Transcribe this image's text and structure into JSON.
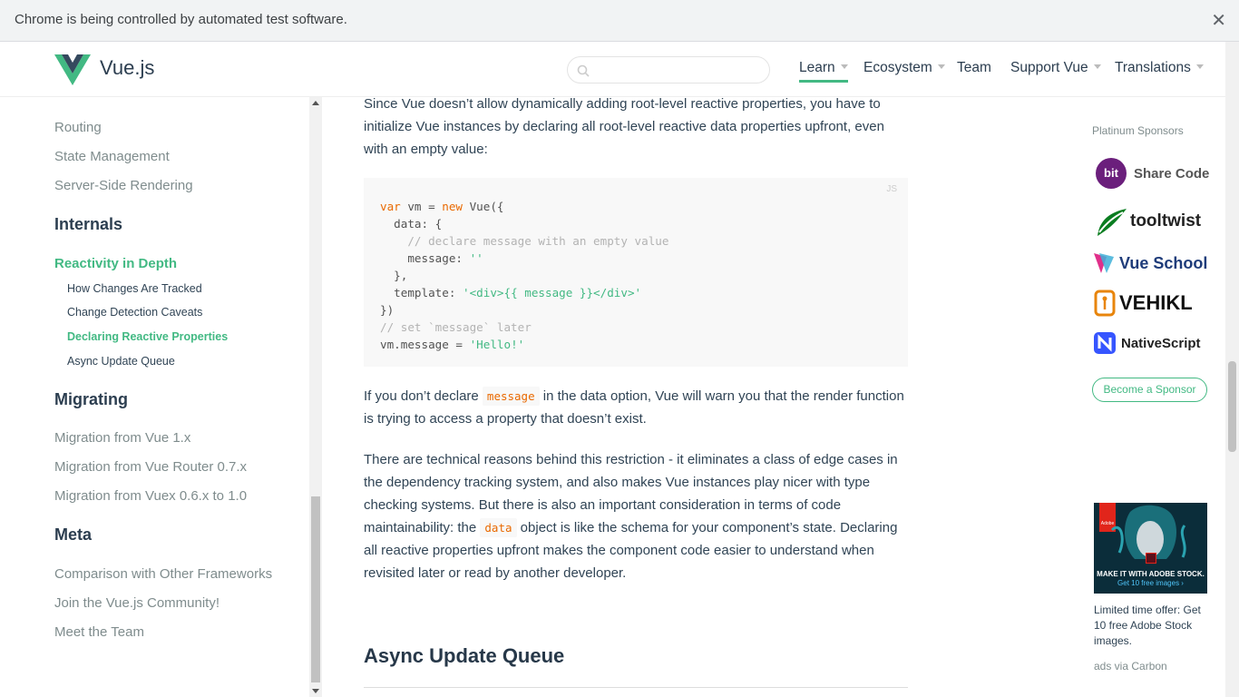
{
  "infobar": {
    "text": "Chrome is being controlled by automated test software.",
    "close": "✕"
  },
  "header": {
    "brand": "Vue.js",
    "search_placeholder": "",
    "nav": [
      {
        "label": "Learn",
        "has_caret": true,
        "active": true
      },
      {
        "label": "Ecosystem",
        "has_caret": true
      },
      {
        "label": "Team",
        "has_caret": false
      },
      {
        "label": "Support Vue",
        "has_caret": true
      },
      {
        "label": "Translations",
        "has_caret": true
      }
    ]
  },
  "sidebar": {
    "links_top": [
      "Routing",
      "State Management",
      "Server-Side Rendering"
    ],
    "internals_heading": "Internals",
    "active_page": "Reactivity in Depth",
    "sub_links": [
      "How Changes Are Tracked",
      "Change Detection Caveats",
      "Declaring Reactive Properties",
      "Async Update Queue"
    ],
    "active_sub": "Declaring Reactive Properties",
    "migrating_heading": "Migrating",
    "migrating_links": [
      "Migration from Vue 1.x",
      "Migration from Vue Router 0.7.x",
      "Migration from Vuex 0.6.x to 1.0"
    ],
    "meta_heading": "Meta",
    "meta_links": [
      "Comparison with Other Frameworks",
      "Join the Vue.js Community!",
      "Meet the Team"
    ]
  },
  "content": {
    "para1": "Since Vue doesn’t allow dynamically adding root-level reactive properties, you have to initialize Vue instances by declaring all root-level reactive data properties upfront, even with an empty value:",
    "code_lang": "JS",
    "code": {
      "l1_kw1": "var",
      "l1_mid": " vm = ",
      "l1_kw2": "new",
      "l1_end": " Vue({",
      "l2": "  data: {",
      "l3": "    // declare message with an empty value",
      "l4_pre": "    message: ",
      "l4_str": "''",
      "l5": "  },",
      "l6_pre": "  template: ",
      "l6_str": "'<div>{{ message }}</div>'",
      "l7": "})",
      "l8": "// set `message` later",
      "l9_pre": "vm.message = ",
      "l9_str": "'Hello!'"
    },
    "para2_a": "If you don’t declare ",
    "para2_code": "message",
    "para2_b": " in the data option, Vue will warn you that the render function is trying to access a property that doesn’t exist.",
    "para3_a": "There are technical reasons behind this restriction - it eliminates a class of edge cases in the dependency tracking system, and also makes Vue instances play nicer with type checking systems. But there is also an important consideration in terms of code maintainability: the ",
    "para3_code": "data",
    "para3_b": " object is like the schema for your component’s state. Declaring all reactive properties upfront makes the component code easier to understand when revisited later or read by another developer.",
    "h2": "Async Update Queue"
  },
  "sponsors": {
    "title": "Platinum Sponsors",
    "items": [
      "Share Code",
      "tooltwist",
      "Vue School",
      "VEHIKL",
      "NativeScript"
    ],
    "bit_logo_text": "bit",
    "become": "Become a Sponsor"
  },
  "ad": {
    "logo_text": "Adobe",
    "tagline": "MAKE IT WITH ADOBE STOCK.",
    "sub": "Get 10 free images ›",
    "caption": "Limited time offer: Get 10 free Adobe Stock images.",
    "via": "ads via Carbon"
  },
  "colors": {
    "accent": "#42b983",
    "text": "#304455",
    "heading": "#2c3e50",
    "muted": "#7f8c8d",
    "code_keyword": "#e96900"
  }
}
